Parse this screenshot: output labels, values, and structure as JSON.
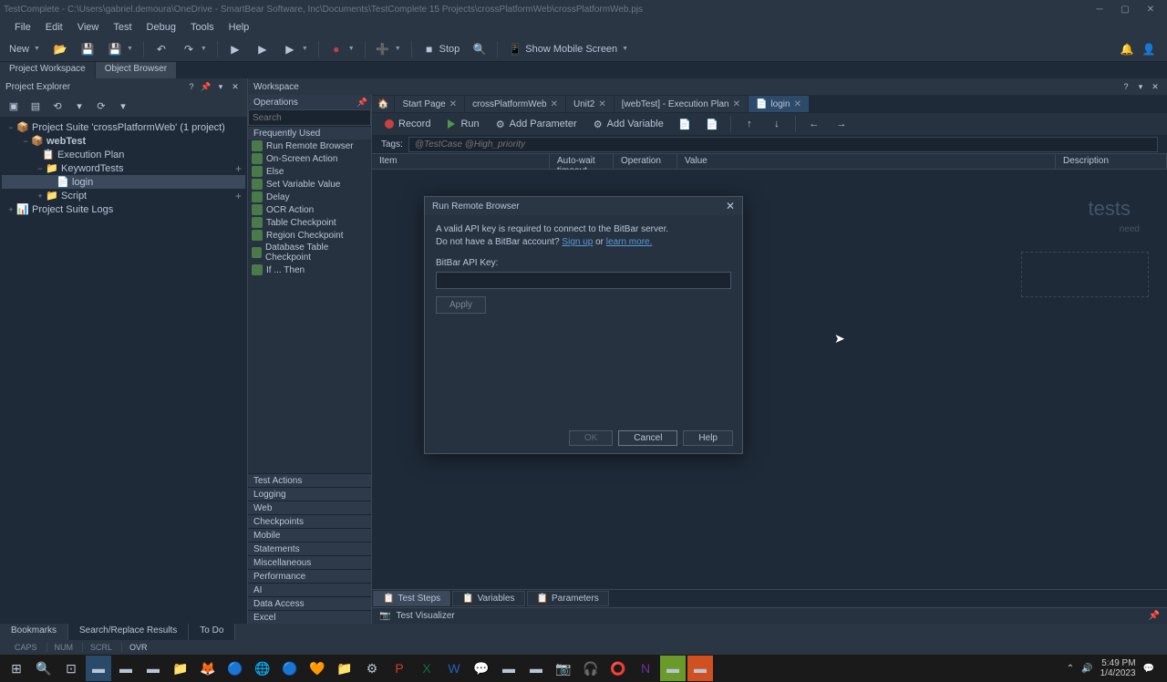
{
  "titlebar": {
    "text": "TestComplete - C:\\Users\\gabriel.demoura\\OneDrive - SmartBear Software, Inc\\Documents\\TestComplete 15 Projects\\crossPlatformWeb\\crossPlatformWeb.pjs"
  },
  "menu": [
    "File",
    "Edit",
    "View",
    "Test",
    "Debug",
    "Tools",
    "Help"
  ],
  "toolbar": {
    "new": "New",
    "stop": "Stop",
    "mobile": "Show Mobile Screen"
  },
  "panel_tabs": {
    "workspace": "Project Workspace",
    "object": "Object Browser"
  },
  "project_explorer": {
    "title": "Project Explorer",
    "root": "Project Suite 'crossPlatformWeb' (1 project)",
    "project": "webTest",
    "nodes": {
      "execution": "Execution Plan",
      "keyword": "KeywordTests",
      "login": "login",
      "script": "Script",
      "logs": "Project Suite Logs"
    }
  },
  "workspace": {
    "title": "Workspace"
  },
  "operations": {
    "title": "Operations",
    "search_placeholder": "Search",
    "frequently": "Frequently Used",
    "items": [
      "Run Remote Browser",
      "On-Screen Action",
      "Else",
      "Set Variable Value",
      "Delay",
      "OCR Action",
      "Table Checkpoint",
      "Region Checkpoint",
      "Database Table Checkpoint",
      "If ... Then"
    ],
    "categories": [
      "Test Actions",
      "Logging",
      "Web",
      "Checkpoints",
      "Mobile",
      "Statements",
      "Miscellaneous",
      "Performance",
      "AI",
      "Data Access",
      "Excel"
    ]
  },
  "tabs": [
    {
      "label": "Start Page"
    },
    {
      "label": "crossPlatformWeb"
    },
    {
      "label": "Unit2"
    },
    {
      "label": "[webTest] - Execution Plan"
    },
    {
      "label": "login"
    }
  ],
  "actions": {
    "record": "Record",
    "run": "Run",
    "add_param": "Add Parameter",
    "add_var": "Add Variable"
  },
  "tags": {
    "label": "Tags:",
    "placeholder": "@TestCase @High_priority"
  },
  "grid_cols": [
    "Item",
    "Auto-wait timeout",
    "Operation",
    "Value",
    "Description"
  ],
  "placeholder": {
    "title": "tests",
    "sub": "need"
  },
  "dialog": {
    "title": "Run Remote Browser",
    "desc1": "A valid API key is required to connect to the BitBar server.",
    "desc2a": "Do not have a BitBar account?  ",
    "signup": "Sign up",
    "or": " or ",
    "learn": "learn more.",
    "label": "BitBar API Key:",
    "apply": "Apply",
    "ok": "OK",
    "cancel": "Cancel",
    "help": "Help"
  },
  "bottom_tabs": [
    "Test Steps",
    "Variables",
    "Parameters"
  ],
  "visualizer": "Test Visualizer",
  "bottom_panel": [
    "Bookmarks",
    "Search/Replace Results",
    "To Do"
  ],
  "status": {
    "caps": "CAPS",
    "num": "NUM",
    "scrl": "SCRL",
    "ovr": "OVR"
  },
  "clock": {
    "time": "5:49 PM",
    "date": "1/4/2023"
  }
}
